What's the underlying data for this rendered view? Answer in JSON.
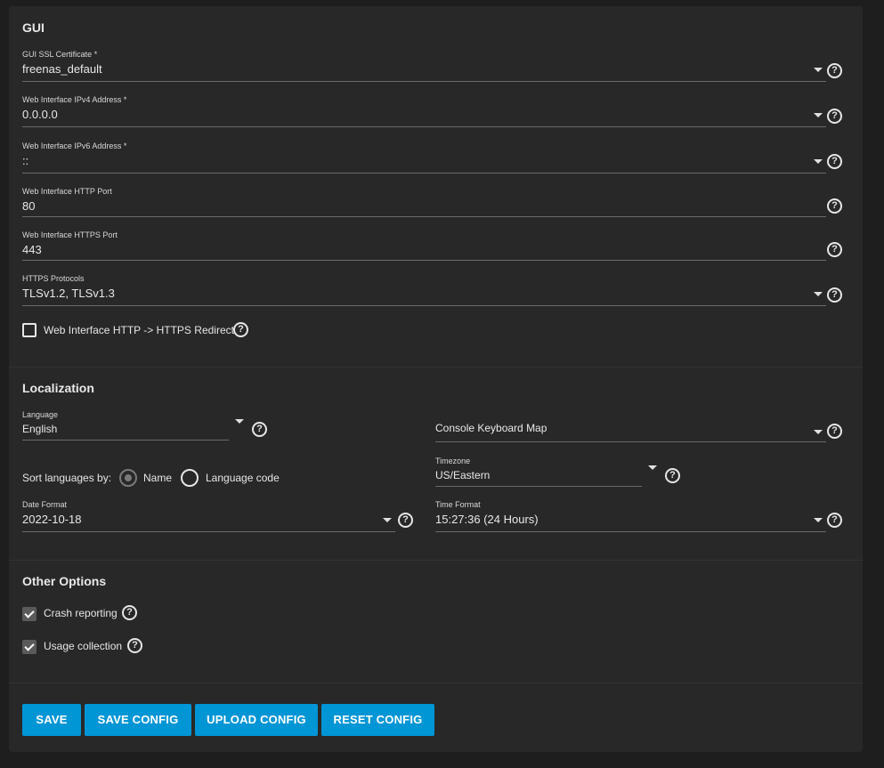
{
  "gui": {
    "title": "GUI",
    "ssl_cert": {
      "label": "GUI SSL Certificate *",
      "value": "freenas_default"
    },
    "ipv4": {
      "label": "Web Interface IPv4 Address *",
      "value": "0.0.0.0"
    },
    "ipv6": {
      "label": "Web Interface IPv6 Address *",
      "value": "::"
    },
    "http_port": {
      "label": "Web Interface HTTP Port",
      "value": "80"
    },
    "https_port": {
      "label": "Web Interface HTTPS Port",
      "value": "443"
    },
    "https_protocols": {
      "label": "HTTPS Protocols",
      "value": "TLSv1.2, TLSv1.3"
    },
    "redirect": {
      "label": "Web Interface HTTP -> HTTPS Redirect",
      "checked": false
    }
  },
  "localization": {
    "title": "Localization",
    "language": {
      "label": "Language",
      "value": "English"
    },
    "keyboard_map": {
      "label": "Console Keyboard Map",
      "value": ""
    },
    "sort": {
      "label": "Sort languages by:",
      "options": [
        "Name",
        "Language code"
      ],
      "selected": "Name"
    },
    "timezone": {
      "label": "Timezone",
      "value": "US/Eastern"
    },
    "date_format": {
      "label": "Date Format",
      "value": "2022-10-18"
    },
    "time_format": {
      "label": "Time Format",
      "value": "15:27:36 (24 Hours)"
    }
  },
  "other": {
    "title": "Other Options",
    "crash": {
      "label": "Crash reporting",
      "checked": true
    },
    "usage": {
      "label": "Usage collection",
      "checked": true
    }
  },
  "buttons": {
    "save": "SAVE",
    "save_config": "SAVE CONFIG",
    "upload_config": "UPLOAD CONFIG",
    "reset_config": "RESET CONFIG"
  },
  "icons": {
    "help": "help-circle-icon",
    "help_glyph": "?",
    "caret": "caret-down-icon",
    "check": "checkmark-icon"
  },
  "colors": {
    "accent": "#0095d5",
    "card": "#282828",
    "background": "#1e1e1e"
  }
}
